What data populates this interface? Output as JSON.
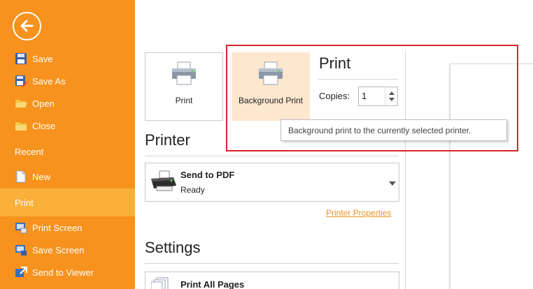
{
  "sidebar": {
    "items_top": [
      {
        "label": "Save",
        "icon": "floppy-disk-icon"
      },
      {
        "label": "Save As",
        "icon": "save-as-icon"
      },
      {
        "label": "Open",
        "icon": "folder-open-icon"
      },
      {
        "label": "Close",
        "icon": "folder-close-icon"
      }
    ],
    "recent": "Recent",
    "new": "New",
    "print": "Print",
    "items_bottom": [
      {
        "label": "Print Screen",
        "icon": "print-screen-icon"
      },
      {
        "label": "Save Screen",
        "icon": "save-screen-icon"
      },
      {
        "label": "Send to Viewer",
        "icon": "send-to-viewer-icon"
      }
    ]
  },
  "print_panel": {
    "print_button": "Print",
    "background_print_button": "Background Print",
    "title": "Print",
    "copies_label": "Copies:",
    "copies_value": "1",
    "tooltip": "Background print to the currently selected printer."
  },
  "printer_section": {
    "title": "Printer",
    "printer_name": "Send to PDF",
    "printer_status": "Ready",
    "properties_link": "Printer Properties"
  },
  "settings_section": {
    "title": "Settings",
    "pages_option": "Print All Pages"
  },
  "colors": {
    "sidebar": "#f7921e",
    "sidebar_selected": "#fbb03b",
    "accent_link": "#e8931d",
    "highlight": "#d7262c"
  }
}
